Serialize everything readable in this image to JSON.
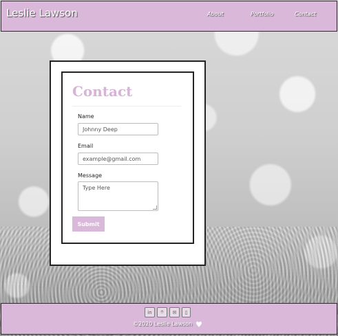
{
  "header": {
    "logo": "Leslie Lawson",
    "nav": {
      "about": "About",
      "portfolio": "Portfolio",
      "contact": "Contact"
    }
  },
  "form": {
    "title": "Contact",
    "name_label": "Name",
    "name_placeholder": "Johnny Deep",
    "email_label": "Email",
    "email_placeholder": "example@gmail.com",
    "message_label": "Message",
    "message_placeholder": "Type Here",
    "submit_label": "Submit"
  },
  "footer": {
    "social_icons": [
      "linkedin-icon",
      "github-icon",
      "mail-icon",
      "phone-icon"
    ],
    "copyright": "©2020 Leslie Lawson"
  },
  "colors": {
    "accent": "#dab8da",
    "title": "#d8b3d8"
  }
}
